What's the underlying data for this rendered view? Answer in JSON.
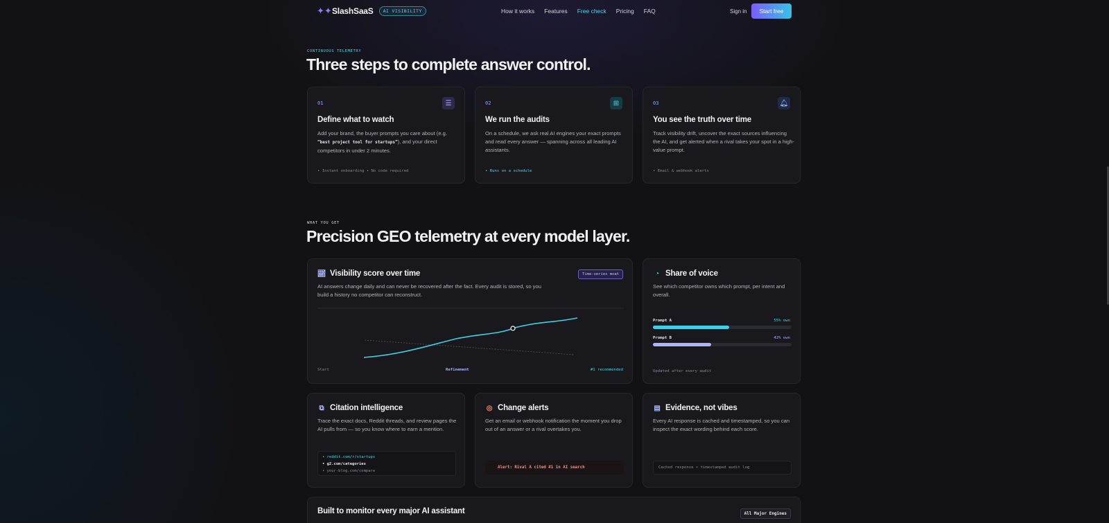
{
  "nav": {
    "brand": "SlashSaaS",
    "badge": "AI VISIBILITY",
    "links": [
      "How it works",
      "Features",
      "Free check",
      "Pricing",
      "FAQ"
    ],
    "active_link": "Free check",
    "signin": "Sign in",
    "cta": "Start free"
  },
  "steps_section": {
    "eyebrow": "CONTINUOUS TELEMETRY",
    "title": "Three steps to complete answer control.",
    "steps": [
      {
        "num": "01",
        "icon": "sliders-icon",
        "title": "Define what to watch",
        "body_pre": "Add your brand, the buyer prompts you care about (e.g. ",
        "body_code": "“best project tool for startups”",
        "body_post": "), and your direct competitors in under 2 minutes.",
        "foot": "• Instant onboarding • No code required"
      },
      {
        "num": "02",
        "icon": "robot-icon",
        "title": "We run the audits",
        "body": "On a schedule, we ask real AI engines your exact prompts and read every answer — spanning across all leading AI assistants.",
        "foot": "• Runs on a schedule"
      },
      {
        "num": "03",
        "icon": "bell-icon",
        "title": "You see the truth over time",
        "body": "Track visibility drift, uncover the exact sources influencing the AI, and get alerted when a rival takes your spot in a high-value prompt.",
        "foot": "• Email & webhook alerts"
      }
    ]
  },
  "features_section": {
    "eyebrow": "WHAT YOU GET",
    "title": "Precision GEO telemetry at every model layer.",
    "visibility": {
      "title": "Visibility score over time",
      "badge": "Time-series moat",
      "body": "AI answers change daily and can never be recovered after the fact. Every audit is stored, so you build a history no competitor can reconstruct.",
      "label_start": "Start",
      "label_mid": "Refinement",
      "label_end": "#1 recommended"
    },
    "share": {
      "title": "Share of voice",
      "body": "See which competitor owns which prompt, per intent and overall.",
      "bars": [
        {
          "label": "Prompt A",
          "value_text": "55% own",
          "value": 0.55,
          "color": "#3fd0e8"
        },
        {
          "label": "Prompt B",
          "value_text": "42% own",
          "value": 0.42,
          "color": "#a9b6ff"
        }
      ],
      "foot": "Updated after every audit"
    },
    "citation": {
      "title": "Citation intelligence",
      "body": "Trace the exact docs, Reddit threads, and review pages the AI pulls from — so you know where to earn a mention.",
      "sources": [
        "reddit.com/r/startups",
        "g2.com/categories",
        "your-blog.com/compare"
      ]
    },
    "alerts": {
      "title": "Change alerts",
      "body": "Get an email or webhook notification the moment you drop out of an answer or a rival overtakes you.",
      "alert": "Alert: Rival A cited #1 in AI search"
    },
    "evidence": {
      "title": "Evidence, not vibes",
      "body": "Every AI response is cached and timestamped, so you can inspect the exact wording behind each score.",
      "log": "Cached response • timestamped audit log"
    },
    "assistants": {
      "title": "Built to monitor every major AI assistant",
      "badge": "All Major Engines"
    }
  }
}
